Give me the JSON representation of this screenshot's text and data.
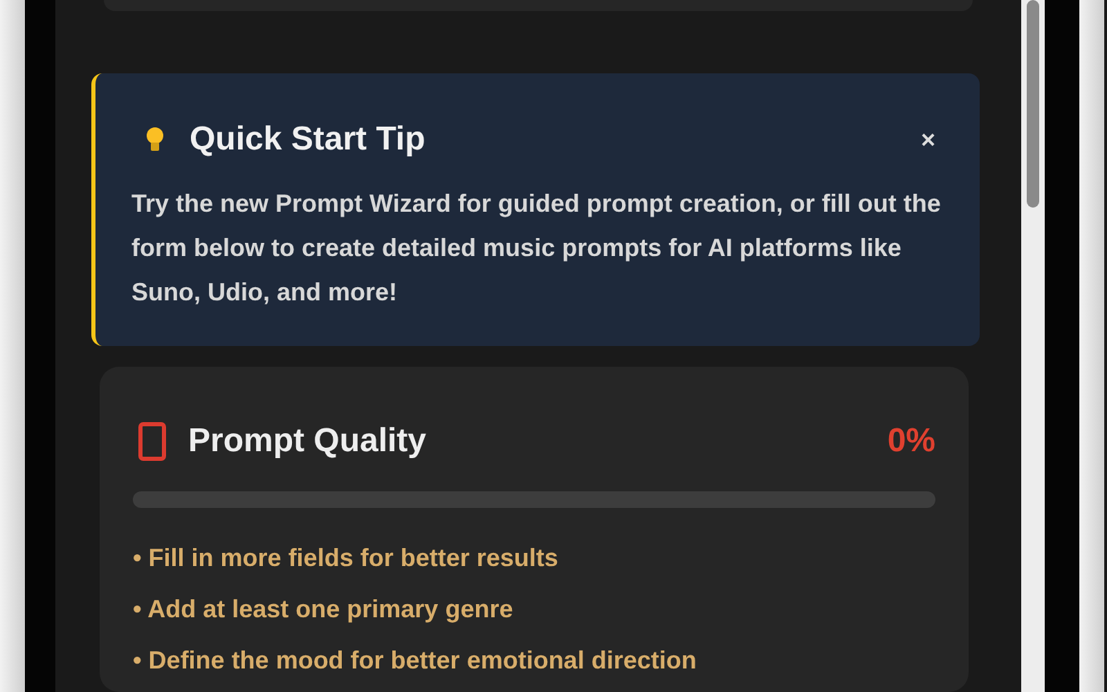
{
  "tip": {
    "title": "Quick Start Tip",
    "close": "×",
    "text": "Try the new Prompt Wizard for guided prompt creation, or fill out the form below to create detailed music prompts for AI platforms like Suno, Udio, and more!"
  },
  "quality": {
    "title": "Prompt Quality",
    "score": "0%",
    "level": 0,
    "suggestions": [
      "• Fill in more fields for better results",
      "• Add at least one primary genre",
      "• Define the mood for better emotional direction"
    ]
  }
}
